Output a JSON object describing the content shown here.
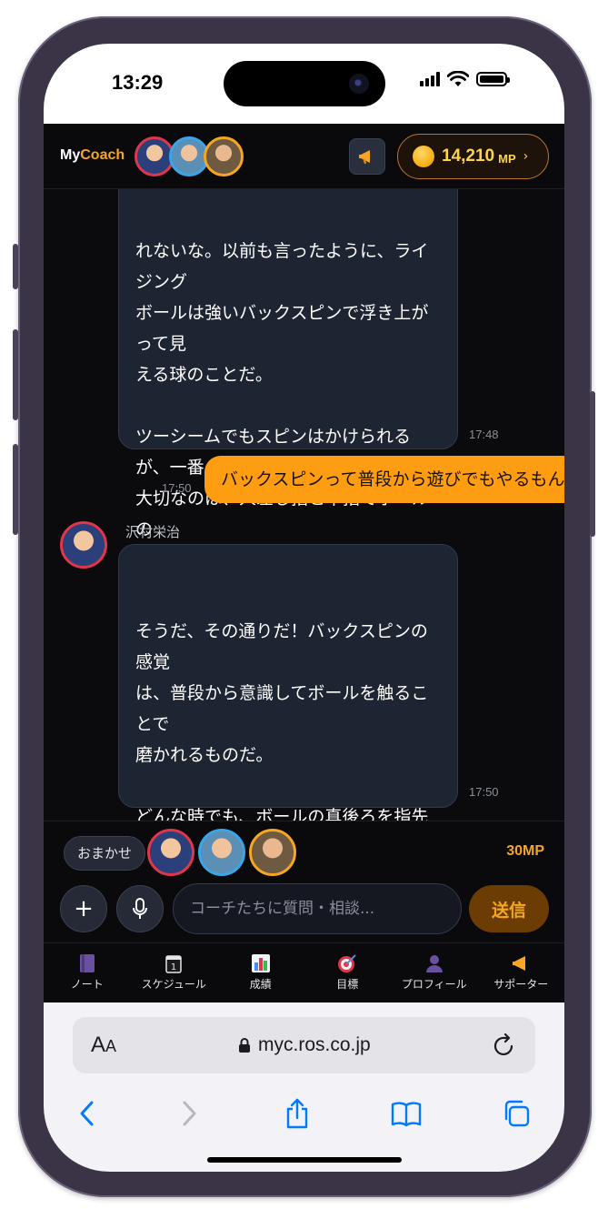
{
  "status_bar": {
    "time": "13:29"
  },
  "header": {
    "logo_my": "My",
    "logo_coach": "Coach",
    "mp_value": "14,210",
    "mp_unit": "MP",
    "mp_chevron": "›"
  },
  "chat": {
    "messages": [
      {
        "role": "coach",
        "text": "れないな。以前も言ったように、ライジング\nボールは強いバックスピンで浮き上がって見\nえる球のことだ。\n\nツーシームでもスピンはかけられるが、一番\n大切なのは、人差し指と中指でボールの\n真後ろをしっかり押して、綺麗なバックスピ\nンをかける感覚だよ。どの握りでも、指先で\nボールを最後まで押し切る意識を持つこと\nが、強い回転を生む秘訣だ。",
        "time": "17:48"
      },
      {
        "role": "user",
        "text": "バックスピンって普段から遊びでもやるもんね",
        "time": "17:50"
      },
      {
        "role": "coach",
        "sender": "沢村栄治",
        "text": "そうだ、その通りだ！バックスピンの感覚\nは、普段から意識してボールを触ることで\n磨かれるものだ。\n\nどんな時でも、ボールの真後ろを指先でしっ\nかりと捉え、押し出す意識で投げてみろ。\n指の感覚は常に研ぎ澄ませておくことが、\n強いスピンを生む第一歩だからな。遊びの\n中でも、その感覚を大切にしろ。",
        "time": "17:50"
      }
    ]
  },
  "input": {
    "omakase_label": "おまかせ",
    "cost": "30MP",
    "placeholder": "コーチたちに質問・相談...",
    "send_label": "送信",
    "plus_label": "+"
  },
  "nav": {
    "items": [
      {
        "label": "ノート",
        "icon": "notebook-icon"
      },
      {
        "label": "スケジュール",
        "icon": "calendar-icon"
      },
      {
        "label": "成績",
        "icon": "bar-chart-icon"
      },
      {
        "label": "目標",
        "icon": "target-icon"
      },
      {
        "label": "プロフィール",
        "icon": "person-icon"
      },
      {
        "label": "サポーター",
        "icon": "megaphone-icon"
      }
    ]
  },
  "browser": {
    "aa_big": "A",
    "aa_small": "A",
    "url": "myc.ros.co.jp"
  },
  "colors": {
    "accent": "#f5a623",
    "user_bubble": "#ff9d12",
    "coach_bubble": "#1e2532"
  }
}
